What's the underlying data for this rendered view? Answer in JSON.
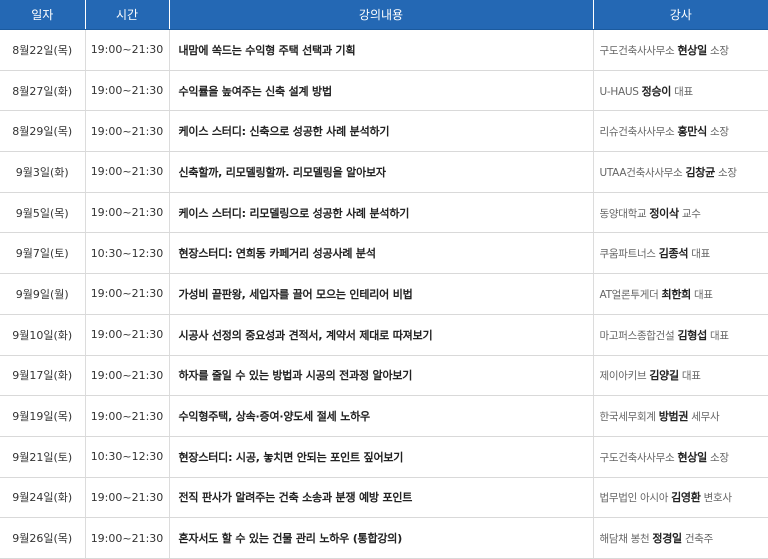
{
  "headers": {
    "date": "일자",
    "time": "시간",
    "topic": "강의내용",
    "lecturer": "강사"
  },
  "rows": [
    {
      "date": "8월22일(목)",
      "time": "19:00~21:30",
      "topic": "내맘에 쏙드는 수익형 주택 선택과 기획",
      "org": "구도건축사사무소",
      "name": "현상일",
      "title": "소장"
    },
    {
      "date": "8월27일(화)",
      "time": "19:00~21:30",
      "topic": "수익률을 높여주는 신축 설계 방법",
      "org": "U-HAUS",
      "name": "정승이",
      "title": "대표"
    },
    {
      "date": "8월29일(목)",
      "time": "19:00~21:30",
      "topic": "케이스 스터디: 신축으로 성공한 사례 분석하기",
      "org": "리슈건축사사무소",
      "name": "홍만식",
      "title": "소장"
    },
    {
      "date": "9월3일(화)",
      "time": "19:00~21:30",
      "topic": "신축할까, 리모델링할까. 리모델링을 알아보자",
      "org": "UTAA건축사사무소",
      "name": "김창균",
      "title": "소장"
    },
    {
      "date": "9월5일(목)",
      "time": "19:00~21:30",
      "topic": "케이스 스터디: 리모델링으로 성공한 사례 분석하기",
      "org": "동양대학교",
      "name": "정이삭",
      "title": "교수"
    },
    {
      "date": "9월7일(토)",
      "time": "10:30~12:30",
      "topic": "현장스터디: 연희동 카페거리 성공사례 분석",
      "org": "쿠움파트너스",
      "name": "김종석",
      "title": "대표"
    },
    {
      "date": "9월9일(월)",
      "time": "19:00~21:30",
      "topic": "가성비 끝판왕, 세입자를 끌어 모으는 인테리어 비법",
      "org": "AT얼론투게더",
      "name": "최한희",
      "title": "대표"
    },
    {
      "date": "9월10일(화)",
      "time": "19:00~21:30",
      "topic": "시공사 선정의 중요성과 견적서, 계약서 제대로 따져보기",
      "org": "마고퍼스종합건설",
      "name": "김형섭",
      "title": "대표"
    },
    {
      "date": "9월17일(화)",
      "time": "19:00~21:30",
      "topic": "하자를 줄일 수 있는 방법과 시공의 전과정 알아보기",
      "org": "제이아키브",
      "name": "김양길",
      "title": "대표"
    },
    {
      "date": "9월19일(목)",
      "time": "19:00~21:30",
      "topic": "수익형주택, 상속·증여·양도세 절세 노하우",
      "org": "한국세무회계",
      "name": "방범권",
      "title": "세무사"
    },
    {
      "date": "9월21일(토)",
      "time": "10:30~12:30",
      "topic": "현장스터디: 시공, 놓치면 안되는 포인트 짚어보기",
      "org": "구도건축사사무소",
      "name": "현상일",
      "title": "소장"
    },
    {
      "date": "9월24일(화)",
      "time": "19:00~21:30",
      "topic": "전직 판사가 알려주는 건축 소송과 분쟁 예방 포인트",
      "org": "법무법인 아시아",
      "name": "김영환",
      "title": "변호사"
    },
    {
      "date": "9월26일(목)",
      "time": "19:00~21:30",
      "topic": "혼자서도 할 수 있는 건물 관리 노하우 (통합강의)",
      "org": "해담채 봉천",
      "name": "정경일",
      "title": "건축주"
    }
  ]
}
